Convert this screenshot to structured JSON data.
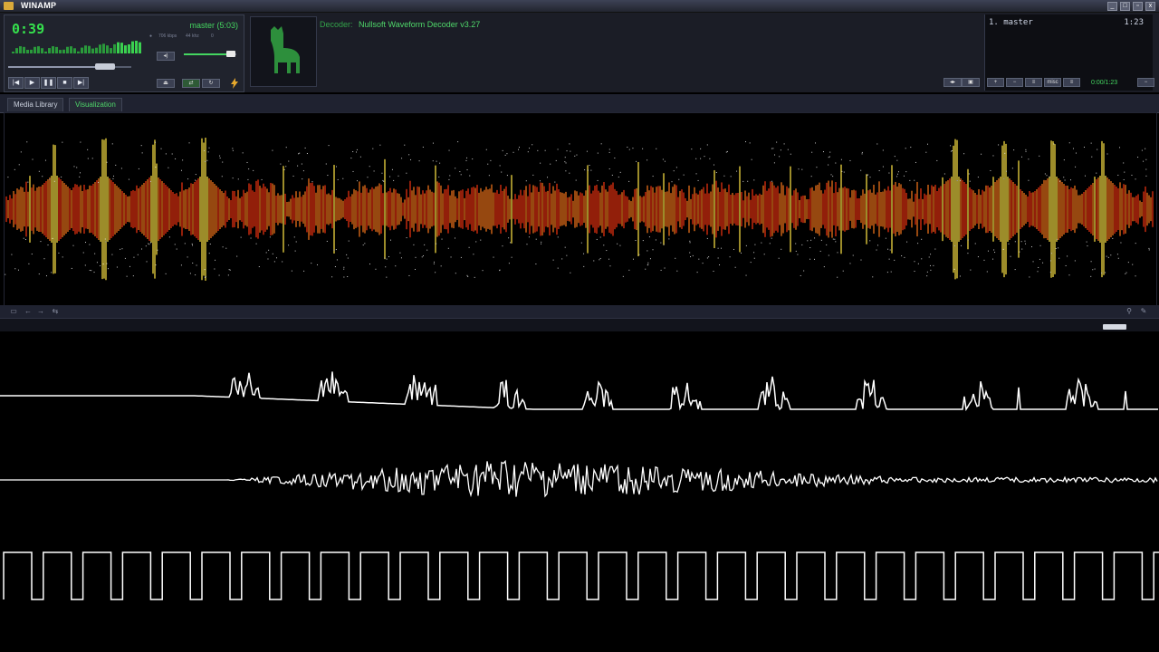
{
  "window": {
    "title": "WINAMP",
    "buttons": [
      "_",
      "□",
      "▫",
      "x"
    ]
  },
  "player": {
    "elapsed": "0:39",
    "song": "master (5:03)",
    "bitrate": "706",
    "bitrate_unit": "kbps",
    "khz": "44",
    "khz_unit": "khz",
    "mode": "0",
    "seek_progress": 0.87,
    "volume": 0.9,
    "controls": [
      "|◀",
      "▶",
      "❚❚",
      "■",
      "▶|"
    ],
    "eject_label": "⏏"
  },
  "decoder": {
    "label": "Decoder:",
    "value": "Nullsoft Waveform Decoder v3.27"
  },
  "playlist": {
    "items": [
      {
        "title": "1. master",
        "length": "1:23"
      }
    ],
    "time": "0:00/1:23",
    "buttons": [
      "+",
      "−",
      "≡",
      "misc",
      "≡"
    ]
  },
  "tabs": [
    {
      "label": "Media Library",
      "active": false
    },
    {
      "label": "Visualization",
      "active": true
    }
  ],
  "vis_controls": [
    "▭",
    "←",
    "→",
    "⇆"
  ],
  "colors": {
    "accent": "#44d660",
    "wave_hot": "#e03010",
    "wave_warm": "#f0d840",
    "scope": "#ffffff"
  },
  "icons": [
    "llama-icon",
    "lightning-icon",
    "wrench-icon",
    "pin-icon"
  ]
}
